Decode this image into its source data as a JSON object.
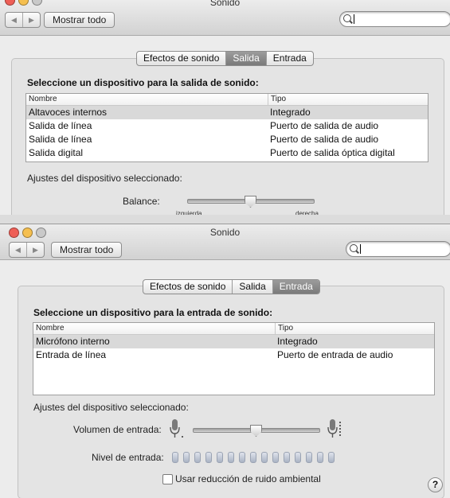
{
  "window_output": {
    "title": "Sonido",
    "show_all": "Mostrar todo",
    "tabs": [
      {
        "label": "Efectos de sonido",
        "selected": false
      },
      {
        "label": "Salida",
        "selected": true
      },
      {
        "label": "Entrada",
        "selected": false
      }
    ],
    "heading": "Seleccione un dispositivo para la salida de sonido:",
    "columns": [
      "Nombre",
      "Tipo"
    ],
    "rows": [
      {
        "name": "Altavoces internos",
        "type": "Integrado",
        "selected": true
      },
      {
        "name": "Salida de línea",
        "type": "Puerto de salida de audio",
        "selected": false
      },
      {
        "name": "Salida de línea",
        "type": "Puerto de salida de audio",
        "selected": false
      },
      {
        "name": "Salida digital",
        "type": "Puerto de salida óptica digital",
        "selected": false
      }
    ],
    "settings_label": "Ajustes del dispositivo seleccionado:",
    "balance_label": "Balance:",
    "balance_value": 0.5,
    "balance_left": "izquierda",
    "balance_right": "derecha"
  },
  "window_input": {
    "title": "Sonido",
    "show_all": "Mostrar todo",
    "tabs": [
      {
        "label": "Efectos de sonido",
        "selected": false
      },
      {
        "label": "Salida",
        "selected": false
      },
      {
        "label": "Entrada",
        "selected": true
      }
    ],
    "heading": "Seleccione un dispositivo para la entrada de sonido:",
    "columns": [
      "Nombre",
      "Tipo"
    ],
    "rows": [
      {
        "name": "Micrófono interno",
        "type": "Integrado",
        "selected": true
      },
      {
        "name": "Entrada de línea",
        "type": "Puerto de entrada de audio",
        "selected": false
      }
    ],
    "settings_label": "Ajustes del dispositivo seleccionado:",
    "volume_label": "Volumen de entrada:",
    "volume_value": 0.5,
    "level_label": "Nivel de entrada:",
    "level_segments": 15,
    "noise_reduction_label": "Usar reducción de ruido ambiental",
    "noise_reduction_checked": false
  },
  "colors": {
    "close": "#ee5f57",
    "minimize": "#f5bf4f",
    "zoom": "#c9c9c9",
    "selected_tab": "#8a8a8a"
  }
}
